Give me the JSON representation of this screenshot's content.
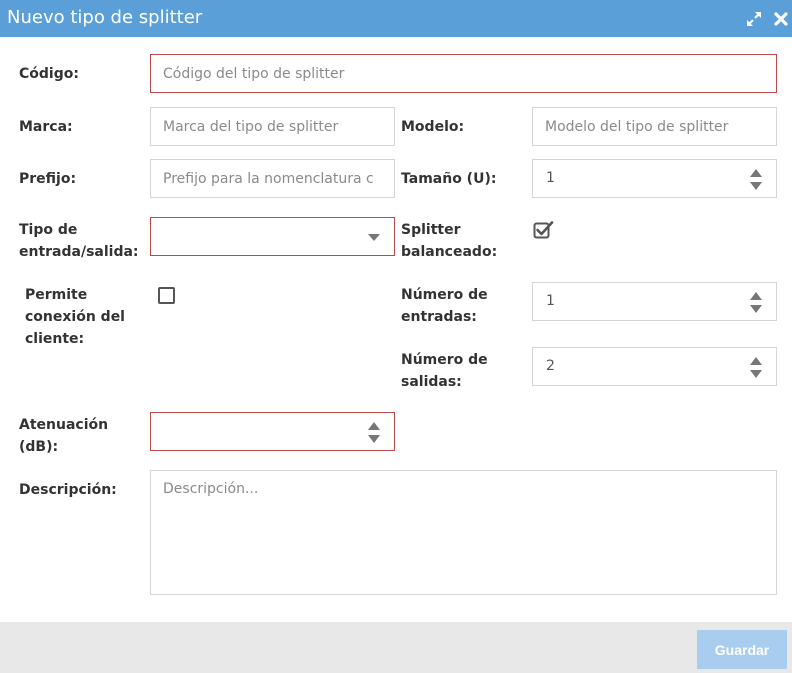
{
  "dialog": {
    "title": "Nuevo tipo de splitter",
    "maximize_icon": "expand-arrows-icon",
    "close_icon": "close-icon"
  },
  "form": {
    "codigo": {
      "label": "Código:",
      "placeholder": "Código del tipo de splitter",
      "value": ""
    },
    "marca": {
      "label": "Marca:",
      "placeholder": "Marca del tipo de splitter",
      "value": ""
    },
    "modelo": {
      "label": "Modelo:",
      "placeholder": "Modelo del tipo de splitter",
      "value": ""
    },
    "prefijo": {
      "label": "Prefijo:",
      "placeholder": "Prefijo para la nomenclatura c",
      "value": ""
    },
    "tamano": {
      "label": "Tamaño (U):",
      "value": "1"
    },
    "tipo_entrada_salida": {
      "label_line1": "Tipo de",
      "label_line2": "entrada/salida:",
      "selected": ""
    },
    "splitter_balanceado": {
      "label_line1": "Splitter",
      "label_line2": "balanceado:",
      "checked": true
    },
    "permite_conexion": {
      "label_line1": "Permite",
      "label_line2": "conexión del",
      "label_line3": "cliente:",
      "checked": false
    },
    "numero_entradas": {
      "label_line1": "Número de",
      "label_line2": "entradas:",
      "value": "1"
    },
    "numero_salidas": {
      "label_line1": "Número de",
      "label_line2": "salidas:",
      "value": "2"
    },
    "atenuacion": {
      "label_line1": "Atenuación",
      "label_line2": "(dB):",
      "value": ""
    },
    "descripcion": {
      "label": "Descripción:",
      "placeholder": "Descripción...",
      "value": ""
    }
  },
  "footer": {
    "save_label": "Guardar"
  },
  "colors": {
    "titlebar": "#5b9fd8",
    "invalid_border": "#b94a48",
    "save_button": "#a9cdee",
    "footer": "#e8e8e8"
  }
}
